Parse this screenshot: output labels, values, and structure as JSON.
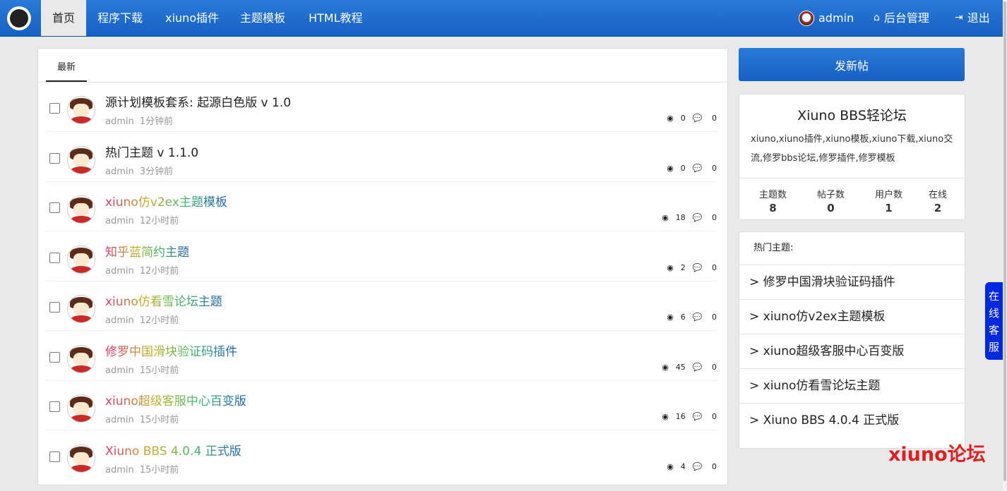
{
  "nav": {
    "items": [
      "首页",
      "程序下载",
      "xiuno插件",
      "主题模板",
      "HTML教程"
    ],
    "user": "admin",
    "admin_label": "后台管理",
    "logout_label": "退出"
  },
  "main": {
    "tab_label": "最新",
    "threads": [
      {
        "title": "源计划模板套系: 起源白色版 v 1.0",
        "author": "admin",
        "time": "1分钟前",
        "views": "0",
        "replies": "0",
        "colorful": false
      },
      {
        "title": "热门主题 v 1.1.0",
        "author": "admin",
        "time": "3分钟前",
        "views": "0",
        "replies": "0",
        "colorful": false
      },
      {
        "title": "xiuno仿v2ex主题模板",
        "author": "admin",
        "time": "12小时前",
        "views": "18",
        "replies": "0",
        "colorful": true
      },
      {
        "title": "知乎蓝简约主题",
        "author": "admin",
        "time": "12小时前",
        "views": "2",
        "replies": "0",
        "colorful": true
      },
      {
        "title": "xiuno仿看雪论坛主题",
        "author": "admin",
        "time": "12小时前",
        "views": "6",
        "replies": "0",
        "colorful": true
      },
      {
        "title": "修罗中国滑块验证码插件",
        "author": "admin",
        "time": "15小时前",
        "views": "45",
        "replies": "0",
        "colorful": true
      },
      {
        "title": "xiuno超级客服中心百变版",
        "author": "admin",
        "time": "15小时前",
        "views": "16",
        "replies": "0",
        "colorful": true
      },
      {
        "title": "Xiuno BBS 4.0.4 正式版",
        "author": "admin",
        "time": "15小时前",
        "views": "4",
        "replies": "0",
        "colorful": true
      }
    ]
  },
  "sidebar": {
    "post_button": "发新帖",
    "site_title": "Xiuno BBS轻论坛",
    "site_desc": "xiuno,xiuno插件,xiuno模板,xiuno下载,xiuno交流,修罗bbs论坛,修罗插件,修罗模板",
    "stats": [
      {
        "label": "主题数",
        "value": "8"
      },
      {
        "label": "帖子数",
        "value": "0"
      },
      {
        "label": "用户数",
        "value": "1"
      },
      {
        "label": "在线",
        "value": "2"
      }
    ],
    "hot_title": "热门主题:",
    "hot_items": [
      "> 修罗中国滑块验证码插件",
      "> xiuno仿v2ex主题模板",
      "> xiuno超级客服中心百变版",
      "> xiuno仿看雪论坛主题",
      "> Xiuno BBS 4.0.4 正式版"
    ]
  },
  "service_tab": "在线客服",
  "watermark": "xiuno论坛"
}
